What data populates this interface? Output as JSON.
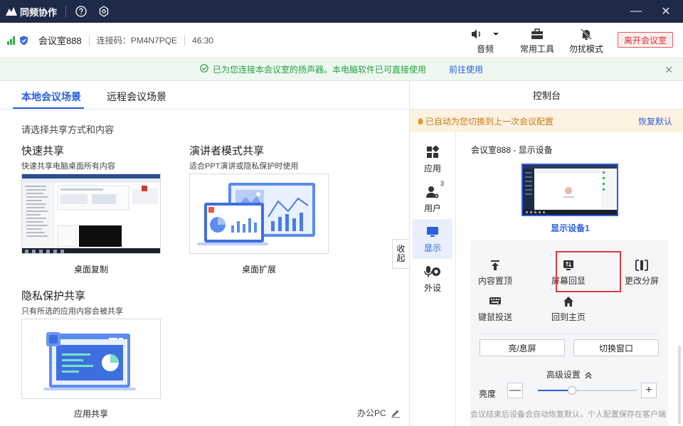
{
  "app": {
    "title": "同频协作"
  },
  "info": {
    "room": "会议室888",
    "code_label": "连接码：PM4N7PQE",
    "timer": "46:30"
  },
  "tools": {
    "audio": "音频",
    "tools": "常用工具",
    "dnd": "勿扰模式"
  },
  "leave_button": "离开会议室",
  "notice": {
    "message": "已为您连接本会议室的扬声器。本电脑软件已可直接使用",
    "link": "前往使用"
  },
  "tabs": {
    "local": "本地会议场景",
    "remote": "远程会议场景"
  },
  "choose_prompt": "请选择共享方式和内容",
  "scenarios": {
    "quick": {
      "title": "快速共享",
      "desc": "快速共享电脑桌面所有内容",
      "option": "桌面复制"
    },
    "presenter": {
      "title": "演讲者模式共享",
      "desc": "适合PPT演讲或隐私保护时使用",
      "option": "桌面扩展"
    },
    "privacy": {
      "title": "隐私保护共享",
      "desc": "只有所选的应用内容会被共享",
      "option": "应用共享"
    }
  },
  "collapse_label": [
    "收",
    "起"
  ],
  "office_pc": "办公PC",
  "control": {
    "title": "控制台",
    "auto_switch": "已自动为您切换到上一次会议配置",
    "restore": "恢复默认",
    "nav": {
      "apps": "应用",
      "users": "用户",
      "users_count": "3",
      "display": "显示",
      "peripherals": "外设"
    },
    "device_title": "会议室888 - 显示设备",
    "device_name": "显示设备1",
    "actions": {
      "pin_top": "内容置顶",
      "screen_echo": "屏幕回显",
      "change_split": "更改分屏",
      "km_cast": "键鼠投送",
      "home": "回到主页"
    },
    "buttons": {
      "screen_toggle": "亮/息屏",
      "switch_window": "切换窗口"
    },
    "advanced": "高级设置",
    "brightness_label": "亮度",
    "brightness_value": 0.34,
    "footnote": "会议结束后设备会自动恢复默认，个人配置保存在客户端"
  },
  "colors": {
    "accent": "#2b5fdc",
    "titlebar": "#1f2a48",
    "success": "#26a045",
    "danger": "#e03a3a",
    "warning": "#c77b18"
  }
}
